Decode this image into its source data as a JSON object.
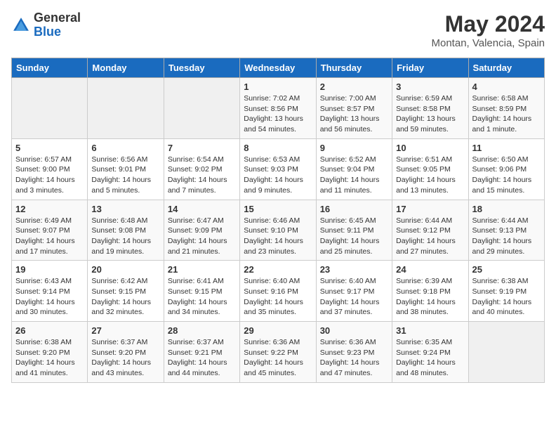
{
  "header": {
    "logo_general": "General",
    "logo_blue": "Blue",
    "title": "May 2024",
    "location": "Montan, Valencia, Spain"
  },
  "weekdays": [
    "Sunday",
    "Monday",
    "Tuesday",
    "Wednesday",
    "Thursday",
    "Friday",
    "Saturday"
  ],
  "weeks": [
    [
      {
        "day": "",
        "info": ""
      },
      {
        "day": "",
        "info": ""
      },
      {
        "day": "",
        "info": ""
      },
      {
        "day": "1",
        "info": "Sunrise: 7:02 AM\nSunset: 8:56 PM\nDaylight: 13 hours\nand 54 minutes."
      },
      {
        "day": "2",
        "info": "Sunrise: 7:00 AM\nSunset: 8:57 PM\nDaylight: 13 hours\nand 56 minutes."
      },
      {
        "day": "3",
        "info": "Sunrise: 6:59 AM\nSunset: 8:58 PM\nDaylight: 13 hours\nand 59 minutes."
      },
      {
        "day": "4",
        "info": "Sunrise: 6:58 AM\nSunset: 8:59 PM\nDaylight: 14 hours\nand 1 minute."
      }
    ],
    [
      {
        "day": "5",
        "info": "Sunrise: 6:57 AM\nSunset: 9:00 PM\nDaylight: 14 hours\nand 3 minutes."
      },
      {
        "day": "6",
        "info": "Sunrise: 6:56 AM\nSunset: 9:01 PM\nDaylight: 14 hours\nand 5 minutes."
      },
      {
        "day": "7",
        "info": "Sunrise: 6:54 AM\nSunset: 9:02 PM\nDaylight: 14 hours\nand 7 minutes."
      },
      {
        "day": "8",
        "info": "Sunrise: 6:53 AM\nSunset: 9:03 PM\nDaylight: 14 hours\nand 9 minutes."
      },
      {
        "day": "9",
        "info": "Sunrise: 6:52 AM\nSunset: 9:04 PM\nDaylight: 14 hours\nand 11 minutes."
      },
      {
        "day": "10",
        "info": "Sunrise: 6:51 AM\nSunset: 9:05 PM\nDaylight: 14 hours\nand 13 minutes."
      },
      {
        "day": "11",
        "info": "Sunrise: 6:50 AM\nSunset: 9:06 PM\nDaylight: 14 hours\nand 15 minutes."
      }
    ],
    [
      {
        "day": "12",
        "info": "Sunrise: 6:49 AM\nSunset: 9:07 PM\nDaylight: 14 hours\nand 17 minutes."
      },
      {
        "day": "13",
        "info": "Sunrise: 6:48 AM\nSunset: 9:08 PM\nDaylight: 14 hours\nand 19 minutes."
      },
      {
        "day": "14",
        "info": "Sunrise: 6:47 AM\nSunset: 9:09 PM\nDaylight: 14 hours\nand 21 minutes."
      },
      {
        "day": "15",
        "info": "Sunrise: 6:46 AM\nSunset: 9:10 PM\nDaylight: 14 hours\nand 23 minutes."
      },
      {
        "day": "16",
        "info": "Sunrise: 6:45 AM\nSunset: 9:11 PM\nDaylight: 14 hours\nand 25 minutes."
      },
      {
        "day": "17",
        "info": "Sunrise: 6:44 AM\nSunset: 9:12 PM\nDaylight: 14 hours\nand 27 minutes."
      },
      {
        "day": "18",
        "info": "Sunrise: 6:44 AM\nSunset: 9:13 PM\nDaylight: 14 hours\nand 29 minutes."
      }
    ],
    [
      {
        "day": "19",
        "info": "Sunrise: 6:43 AM\nSunset: 9:14 PM\nDaylight: 14 hours\nand 30 minutes."
      },
      {
        "day": "20",
        "info": "Sunrise: 6:42 AM\nSunset: 9:15 PM\nDaylight: 14 hours\nand 32 minutes."
      },
      {
        "day": "21",
        "info": "Sunrise: 6:41 AM\nSunset: 9:15 PM\nDaylight: 14 hours\nand 34 minutes."
      },
      {
        "day": "22",
        "info": "Sunrise: 6:40 AM\nSunset: 9:16 PM\nDaylight: 14 hours\nand 35 minutes."
      },
      {
        "day": "23",
        "info": "Sunrise: 6:40 AM\nSunset: 9:17 PM\nDaylight: 14 hours\nand 37 minutes."
      },
      {
        "day": "24",
        "info": "Sunrise: 6:39 AM\nSunset: 9:18 PM\nDaylight: 14 hours\nand 38 minutes."
      },
      {
        "day": "25",
        "info": "Sunrise: 6:38 AM\nSunset: 9:19 PM\nDaylight: 14 hours\nand 40 minutes."
      }
    ],
    [
      {
        "day": "26",
        "info": "Sunrise: 6:38 AM\nSunset: 9:20 PM\nDaylight: 14 hours\nand 41 minutes."
      },
      {
        "day": "27",
        "info": "Sunrise: 6:37 AM\nSunset: 9:20 PM\nDaylight: 14 hours\nand 43 minutes."
      },
      {
        "day": "28",
        "info": "Sunrise: 6:37 AM\nSunset: 9:21 PM\nDaylight: 14 hours\nand 44 minutes."
      },
      {
        "day": "29",
        "info": "Sunrise: 6:36 AM\nSunset: 9:22 PM\nDaylight: 14 hours\nand 45 minutes."
      },
      {
        "day": "30",
        "info": "Sunrise: 6:36 AM\nSunset: 9:23 PM\nDaylight: 14 hours\nand 47 minutes."
      },
      {
        "day": "31",
        "info": "Sunrise: 6:35 AM\nSunset: 9:24 PM\nDaylight: 14 hours\nand 48 minutes."
      },
      {
        "day": "",
        "info": ""
      }
    ]
  ]
}
